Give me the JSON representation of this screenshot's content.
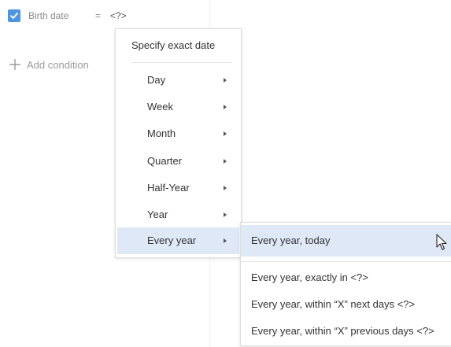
{
  "condition": {
    "checked": true,
    "field": "Birth date",
    "operator": "=",
    "value": "<?>",
    "checkbox_icon": "checkmark-icon"
  },
  "add_condition": {
    "label": "Add condition",
    "icon": "plus-icon"
  },
  "menu": {
    "header": "Specify exact date",
    "items": [
      {
        "label": "Day"
      },
      {
        "label": "Week"
      },
      {
        "label": "Month"
      },
      {
        "label": "Quarter"
      },
      {
        "label": "Half-Year"
      },
      {
        "label": "Year"
      },
      {
        "label": "Every year",
        "active": true
      }
    ]
  },
  "submenu": {
    "items": [
      {
        "label": "Every year, today",
        "active": true
      },
      {
        "label": "Every year, exactly in <?>"
      },
      {
        "label": "Every year, within “X” next days <?>"
      },
      {
        "label": "Every year, within “X” previous days <?>"
      }
    ]
  },
  "colors": {
    "accent": "#4f95dd",
    "highlight": "#dfe8f7",
    "muted_text": "#8a8a8a"
  }
}
